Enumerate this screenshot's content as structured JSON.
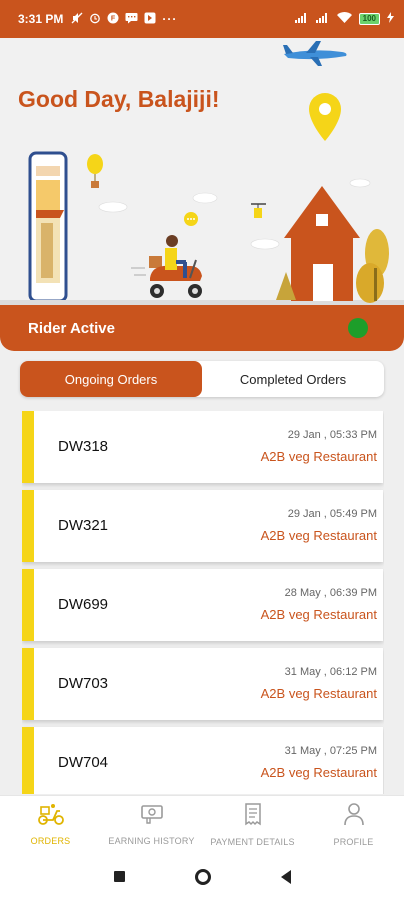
{
  "status_bar": {
    "time": "3:31 PM",
    "battery": "100",
    "icons": [
      "mute-icon",
      "alarm-icon",
      "app-icon",
      "message-icon",
      "app-icon-2",
      "more-icon"
    ],
    "right_icons": [
      "signal-icon",
      "signal-icon-2",
      "wifi-icon",
      "battery-icon",
      "charging-icon"
    ]
  },
  "header": {
    "greeting": "Good Day, Balajiji!"
  },
  "rider_status": {
    "label": "Rider Active",
    "indicator_color": "#1d9e2a"
  },
  "tabs": [
    {
      "label": "Ongoing Orders",
      "active": true
    },
    {
      "label": "Completed Orders",
      "active": false
    }
  ],
  "orders": [
    {
      "id": "DW318",
      "date": "29 Jan , 05:33 PM",
      "restaurant": "A2B veg Restaurant"
    },
    {
      "id": "DW321",
      "date": "29 Jan , 05:49 PM",
      "restaurant": "A2B veg Restaurant"
    },
    {
      "id": "DW699",
      "date": "28 May , 06:39 PM",
      "restaurant": "A2B veg Restaurant"
    },
    {
      "id": "DW703",
      "date": "31 May , 06:12 PM",
      "restaurant": "A2B veg Restaurant"
    },
    {
      "id": "DW704",
      "date": "31 May , 07:25 PM",
      "restaurant": "A2B veg Restaurant"
    }
  ],
  "bottom_nav": [
    {
      "label": "ORDERS",
      "icon": "scooter-icon",
      "active": true
    },
    {
      "label": "EARNING HISTORY",
      "icon": "cash-icon",
      "active": false
    },
    {
      "label": "PAYMENT DETAILS",
      "icon": "receipt-icon",
      "active": false
    },
    {
      "label": "PROFILE",
      "icon": "person-icon",
      "active": false
    }
  ],
  "colors": {
    "brand": "#c9541d",
    "accent_yellow": "#f5d518",
    "active_nav": "#e0b400"
  }
}
